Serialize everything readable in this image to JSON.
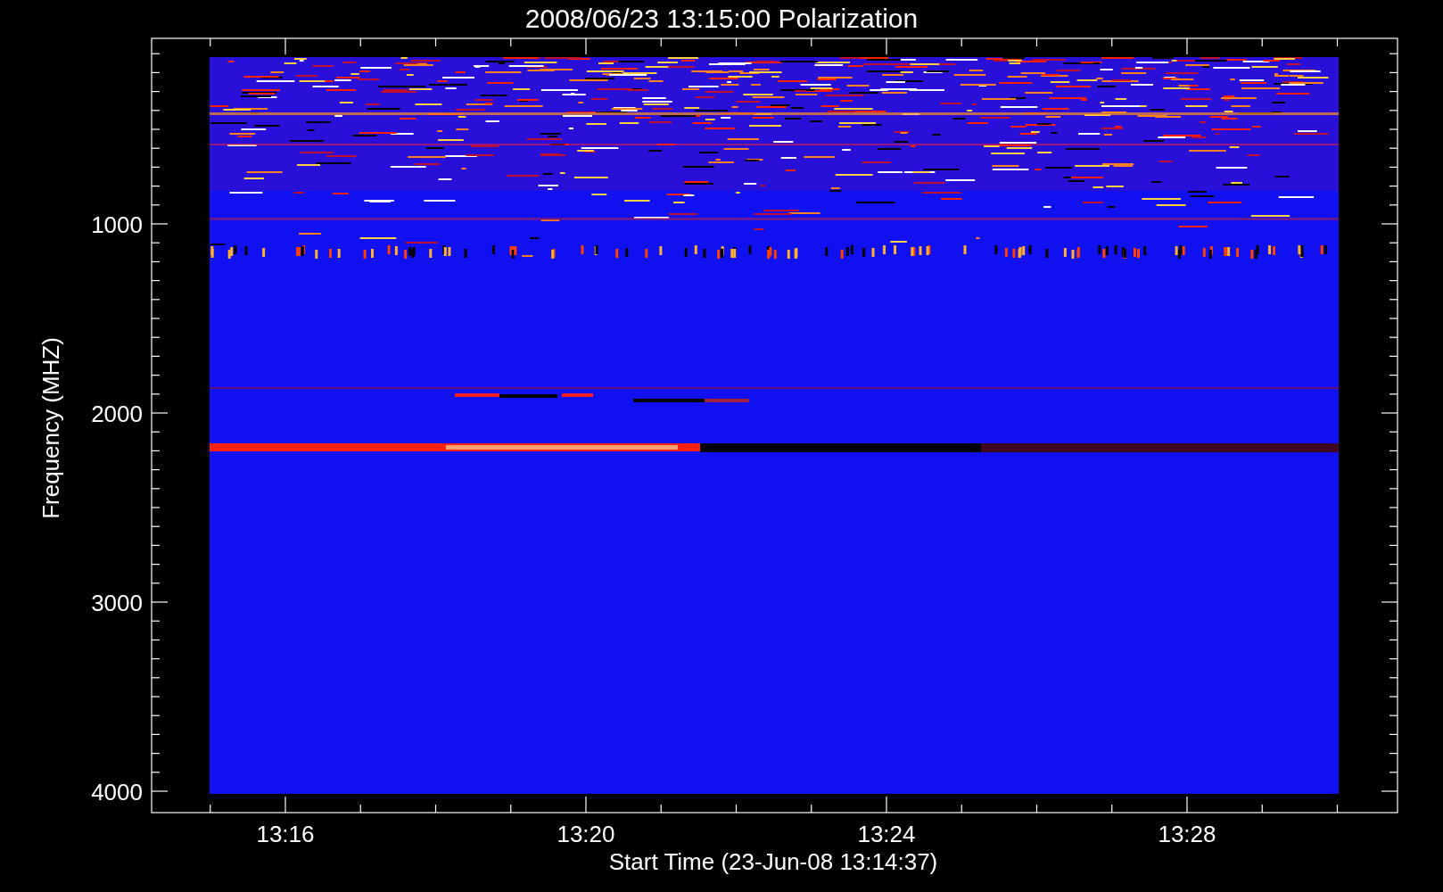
{
  "plot": {
    "title": "2008/06/23 13:15:00 Polarization",
    "ylabel": "Frequency (MHZ)",
    "xlabel": "Start Time (23-Jun-08 13:14:37)",
    "yticks": [
      "1000",
      "2000",
      "3000",
      "4000"
    ],
    "xticks": [
      "13:16",
      "13:20",
      "13:24",
      "13:28"
    ]
  }
}
